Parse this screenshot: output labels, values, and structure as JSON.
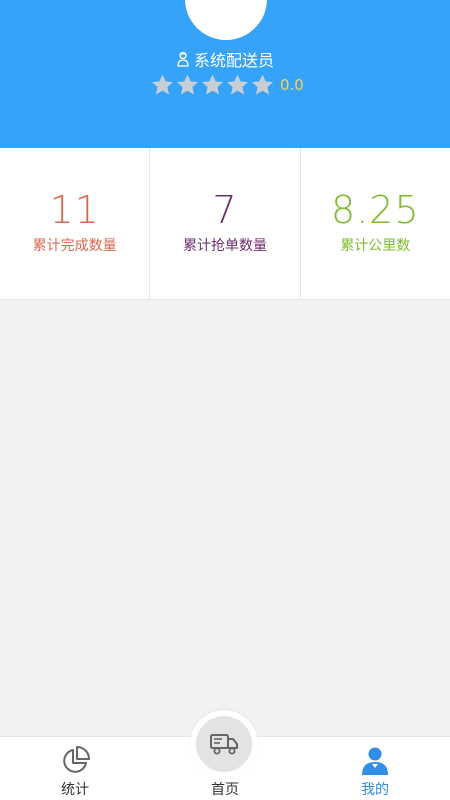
{
  "header": {
    "role_label": "系统配送员",
    "rating": 0.0,
    "rating_text": "0.0",
    "max_stars": 5
  },
  "stats": [
    {
      "value": "11",
      "label": "累计完成数量",
      "color": "#d9684d"
    },
    {
      "value": "7",
      "label": "累计抢单数量",
      "color": "#6b2f6e"
    },
    {
      "value": "8.25",
      "label": "累计公里数",
      "color": "#7dbb2e"
    }
  ],
  "tabbar": {
    "tabs": [
      {
        "label": "统计",
        "icon": "pie-chart-icon",
        "active": false
      },
      {
        "label": "首页",
        "icon": "truck-icon",
        "active": false
      },
      {
        "label": "我的",
        "icon": "user-icon",
        "active": true
      }
    ]
  },
  "colors": {
    "brand": "#35a3fa",
    "active_tab": "#2f8ee6",
    "inactive_tab": "#333333",
    "rating": "#ffd24a"
  }
}
